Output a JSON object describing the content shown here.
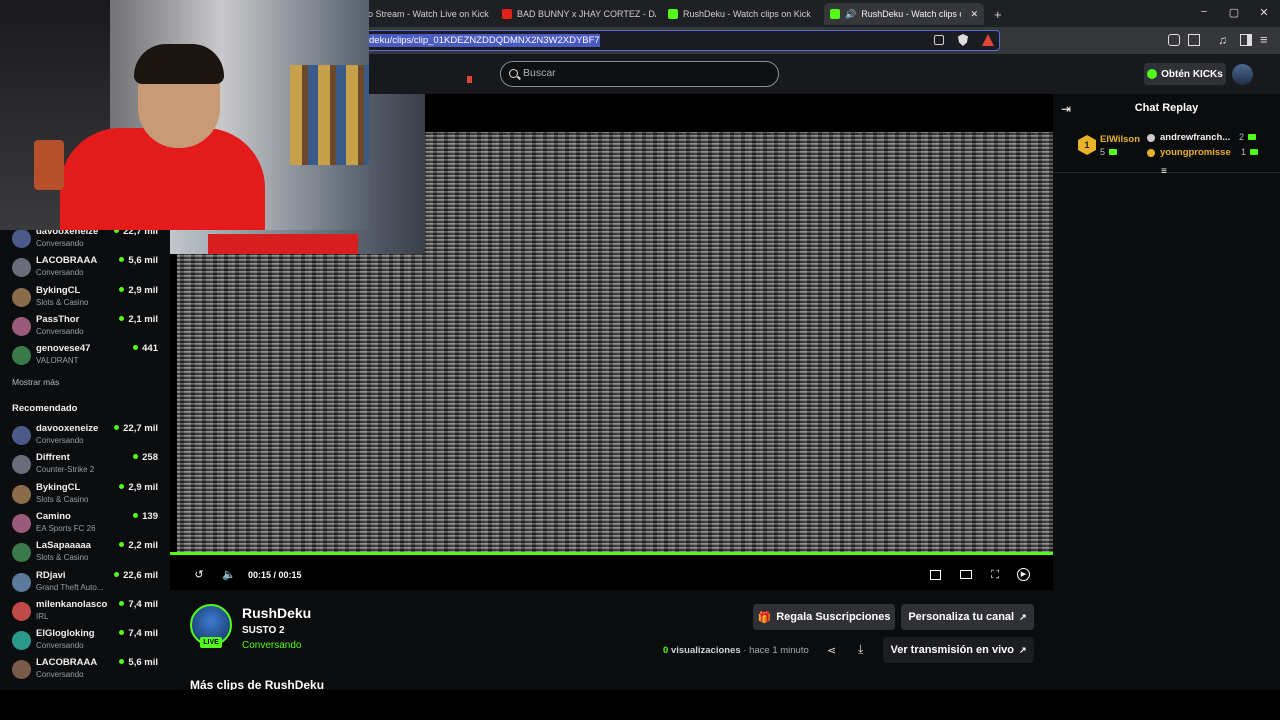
{
  "browser": {
    "tabs": [
      {
        "title": "o Stream - Watch Live on Kick",
        "icon": "kick"
      },
      {
        "title": "BAD BUNNY x JHAY CORTEZ - DÁKITI",
        "icon": "youtube"
      },
      {
        "title": "RushDeku - Watch clips on Kick",
        "icon": "kick"
      },
      {
        "title": "RushDeku - Watch clips on Kick",
        "icon": "kick",
        "active": true
      }
    ],
    "new_tab": "+",
    "url": "deku/clips/clip_01KDEZNZDDQDMNX2N3W2XDYBF7",
    "win_min": "−",
    "win_max": "▢",
    "win_close": "✕"
  },
  "header": {
    "search_placeholder": "Buscar",
    "kicks_button": "Obtén KICKs"
  },
  "sidebar": {
    "top_items": [
      {
        "name": "davooxeneize",
        "category": "Conversando",
        "viewers": "22,7 mil"
      },
      {
        "name": "LACOBRAAA",
        "category": "Conversando",
        "viewers": "5,6 mil"
      },
      {
        "name": "BykingCL",
        "category": "Slots & Casino",
        "viewers": "2,9 mil"
      },
      {
        "name": "PassThor",
        "category": "Conversando",
        "viewers": "2,1 mil"
      },
      {
        "name": "genovese47",
        "category": "VALORANT",
        "viewers": "441"
      }
    ],
    "show_more": "Mostrar más",
    "recommended_title": "Recomendado",
    "recommended": [
      {
        "name": "davooxeneize",
        "category": "Conversando",
        "viewers": "22,7 mil"
      },
      {
        "name": "Diffrent",
        "category": "Counter-Strike 2",
        "viewers": "258"
      },
      {
        "name": "BykingCL",
        "category": "Slots & Casino",
        "viewers": "2,9 mil"
      },
      {
        "name": "Camino",
        "category": "EA Sports FC 26",
        "viewers": "139"
      },
      {
        "name": "LaSapaaaaa",
        "category": "Slots & Casino",
        "viewers": "2,2 mil"
      },
      {
        "name": "RDjavi",
        "category": "Grand Theft Auto...",
        "viewers": "22,6 mil"
      },
      {
        "name": "milenkanolasco",
        "category": "IRL",
        "viewers": "7,4 mil"
      },
      {
        "name": "ElGlogloking",
        "category": "Conversando",
        "viewers": "7,4 mil"
      },
      {
        "name": "LACOBRAAA",
        "category": "Conversando",
        "viewers": "5,6 mil"
      }
    ]
  },
  "player": {
    "time": "00:15 / 00:15",
    "progress": 1.0
  },
  "clip": {
    "channel": "RushDeku",
    "title": "SUSTO 2",
    "category": "Conversando",
    "live_badge": "LIVE",
    "gift_button": "Regala Suscripciones",
    "customize_button": "Personaliza tu canal",
    "view_count": "0",
    "views_label": "visualizaciones",
    "time_ago": "· hace 1 minuto",
    "watch_live_button": "Ver transmisión en vivo",
    "more_clips": "Más clips de RushDeku"
  },
  "chat": {
    "title": "Chat Replay",
    "leader_rank": "1",
    "leader_name": "ElWilson",
    "leader_count": "5",
    "gifters": [
      {
        "name": "andrewfranch...",
        "count": "2"
      },
      {
        "name": "youngpromisse",
        "count": "1"
      }
    ]
  },
  "colors": {
    "accent": "#53fc18",
    "background": "#0b0c0e",
    "gold": "#e8b12a"
  }
}
